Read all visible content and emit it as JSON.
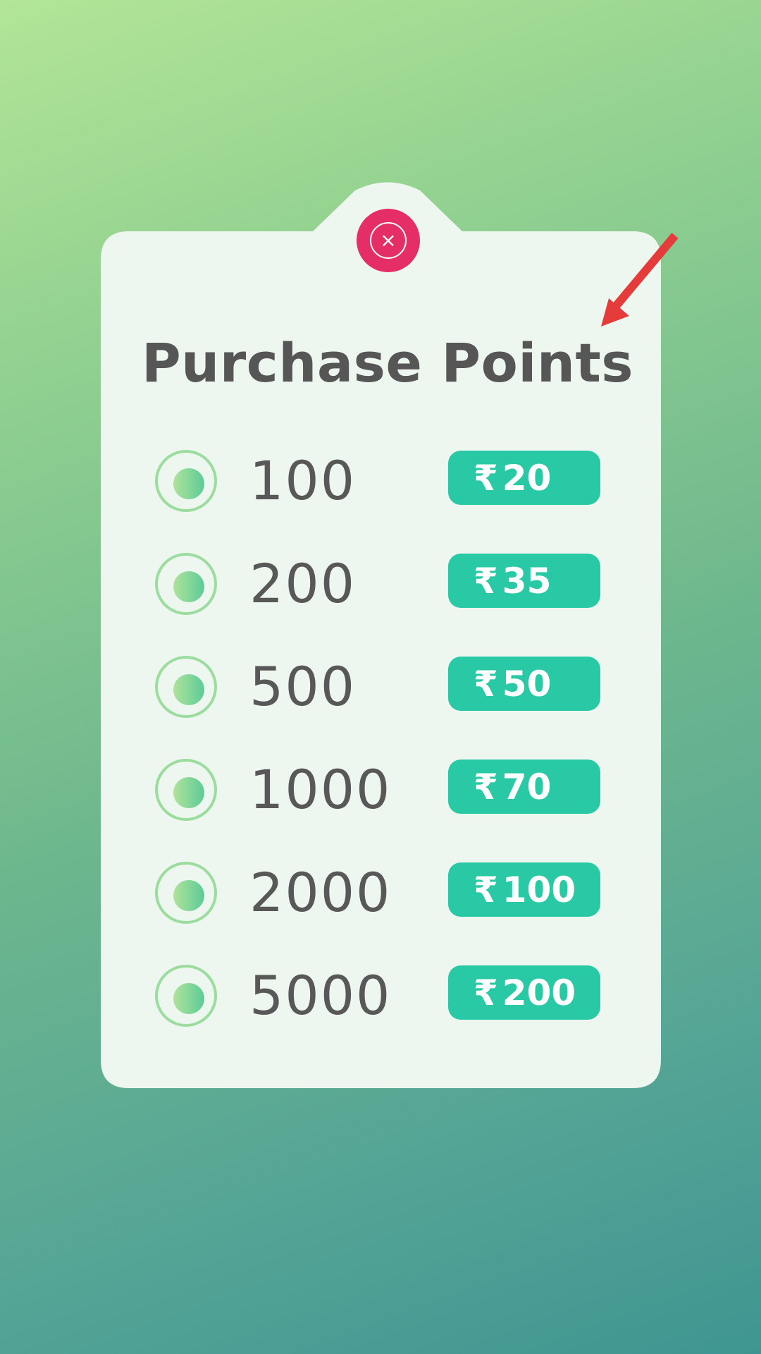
{
  "colors": {
    "card": "#edf7ef",
    "close_button": "#e62e66",
    "price_button": "#29c9a6",
    "arrow": "#e53b3b",
    "text": "#565656"
  },
  "close_button": {
    "icon": "close-icon",
    "glyph": "×"
  },
  "title": "Purchase Points",
  "options": [
    {
      "points": "100",
      "currency": "₹",
      "price": "20"
    },
    {
      "points": "200",
      "currency": "₹",
      "price": "35"
    },
    {
      "points": "500",
      "currency": "₹",
      "price": "50"
    },
    {
      "points": "1000",
      "currency": "₹",
      "price": "70"
    },
    {
      "points": "2000",
      "currency": "₹",
      "price": "100"
    },
    {
      "points": "5000",
      "currency": "₹",
      "price": "200"
    }
  ]
}
